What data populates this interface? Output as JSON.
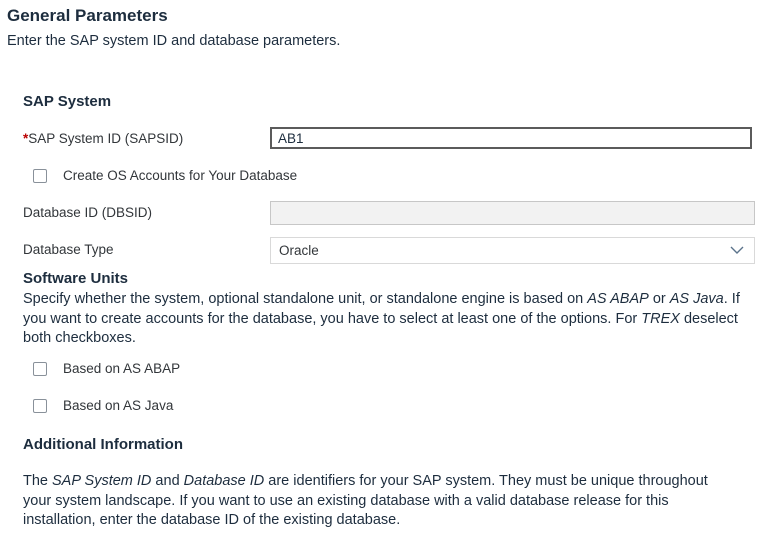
{
  "header": {
    "title": "General Parameters",
    "subtitle": "Enter the SAP system ID and database parameters."
  },
  "sap_system": {
    "section_title": "SAP System",
    "sapsid_label": "SAP System ID (SAPSID)",
    "sapsid_required_marker": "*",
    "sapsid_value": "AB1",
    "create_os_accounts_label": "Create OS Accounts for Your Database",
    "create_os_accounts_checked": false,
    "dbsid_label": "Database ID (DBSID)",
    "dbsid_value": "",
    "db_type_label": "Database Type",
    "db_type_value": "Oracle"
  },
  "software_units": {
    "section_title": "Software Units",
    "description_parts": [
      "Specify whether the system, optional standalone unit, or standalone engine is based on ",
      "AS ABAP",
      " or ",
      "AS Java",
      ". If you want to create accounts for the database, you have to select at least one of the options. For ",
      "TREX",
      " deselect both checkboxes."
    ],
    "abap_label": "Based on AS ABAP",
    "abap_checked": false,
    "java_label": "Based on AS Java",
    "java_checked": false
  },
  "additional_info": {
    "section_title": "Additional Information",
    "text_parts": [
      "The ",
      "SAP System ID",
      " and ",
      "Database ID",
      " are identifiers for your SAP system. They must be unique throughout your system landscape. If you want to use an existing database with a valid database release for this installation, enter the database ID of the existing database."
    ]
  },
  "icons": {
    "select_arrow": "chevron-down-icon"
  }
}
